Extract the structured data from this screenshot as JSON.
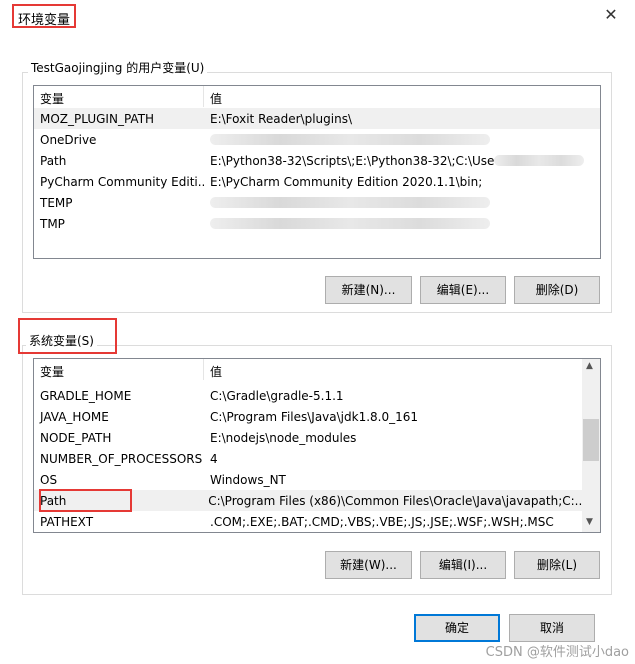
{
  "window": {
    "title": "环境变量",
    "close": "✕"
  },
  "user": {
    "label": "TestGaojingjing 的用户变量(U)",
    "headers": [
      "变量",
      "值"
    ],
    "rows": [
      {
        "name": "MOZ_PLUGIN_PATH",
        "value": "E:\\Foxit Reader\\plugins\\",
        "blur": false
      },
      {
        "name": "OneDrive",
        "value": "",
        "blur": true
      },
      {
        "name": "Path",
        "value": "E:\\Python38-32\\Scripts\\;E:\\Python38-32\\;C:\\Use",
        "blur": true
      },
      {
        "name": "PyCharm Community Editi...",
        "value": "E:\\PyCharm Community Edition 2020.1.1\\bin;",
        "blur": false
      },
      {
        "name": "TEMP",
        "value": "",
        "blur": true
      },
      {
        "name": "TMP",
        "value": "",
        "blur": true
      }
    ],
    "buttons": {
      "new": "新建(N)...",
      "edit": "编辑(E)...",
      "delete": "删除(D)"
    }
  },
  "system": {
    "label": "系统变量(S)",
    "headers": [
      "变量",
      "值"
    ],
    "rows": [
      {
        "name": "GRADLE_HOME",
        "value": "C:\\Gradle\\gradle-5.1.1"
      },
      {
        "name": "JAVA_HOME",
        "value": "C:\\Program Files\\Java\\jdk1.8.0_161"
      },
      {
        "name": "NODE_PATH",
        "value": "E:\\nodejs\\node_modules"
      },
      {
        "name": "NUMBER_OF_PROCESSORS",
        "value": "4"
      },
      {
        "name": "OS",
        "value": "Windows_NT"
      },
      {
        "name": "Path",
        "value": "C:\\Program Files (x86)\\Common Files\\Oracle\\Java\\javapath;C:..."
      },
      {
        "name": "PATHEXT",
        "value": ".COM;.EXE;.BAT;.CMD;.VBS;.VBE;.JS;.JSE;.WSF;.WSH;.MSC"
      }
    ],
    "selected_index": 5,
    "buttons": {
      "new": "新建(W)...",
      "edit": "编辑(I)...",
      "delete": "删除(L)"
    }
  },
  "footer": {
    "ok": "确定",
    "cancel": "取消"
  },
  "watermark": "CSDN @软件测试小dao",
  "colors": {
    "highlight": "#e53935",
    "accent": "#0078d7"
  }
}
